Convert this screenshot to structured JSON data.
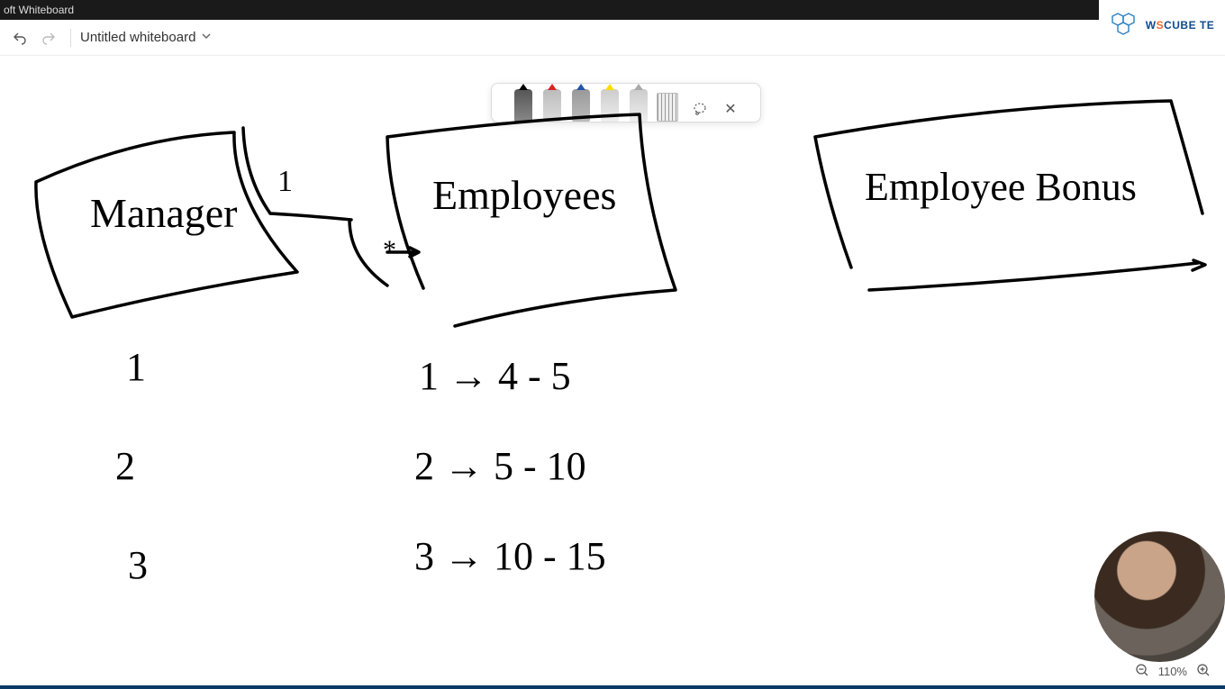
{
  "window": {
    "title": "oft Whiteboard"
  },
  "header": {
    "doc_title": "Untitled whiteboard"
  },
  "pen_tray": {
    "pens": [
      "black",
      "red",
      "blue",
      "yellow",
      "gray"
    ],
    "ruler": "ruler",
    "lasso": "lasso-select",
    "close": "✕"
  },
  "logo": {
    "brand_pre": "W",
    "brand_mid": "S",
    "brand_rest": "CUBE TE"
  },
  "zoom": {
    "level": "110%"
  },
  "drawing": {
    "box1": "Manager",
    "box2": "Employees",
    "box3": "Employee  Bonus",
    "rel1": "1",
    "relStar": "*",
    "col1": [
      "1",
      "2",
      "3"
    ],
    "col2": [
      "1 → 4 - 5",
      "2 → 5 - 10",
      "3 → 10 - 15"
    ]
  }
}
